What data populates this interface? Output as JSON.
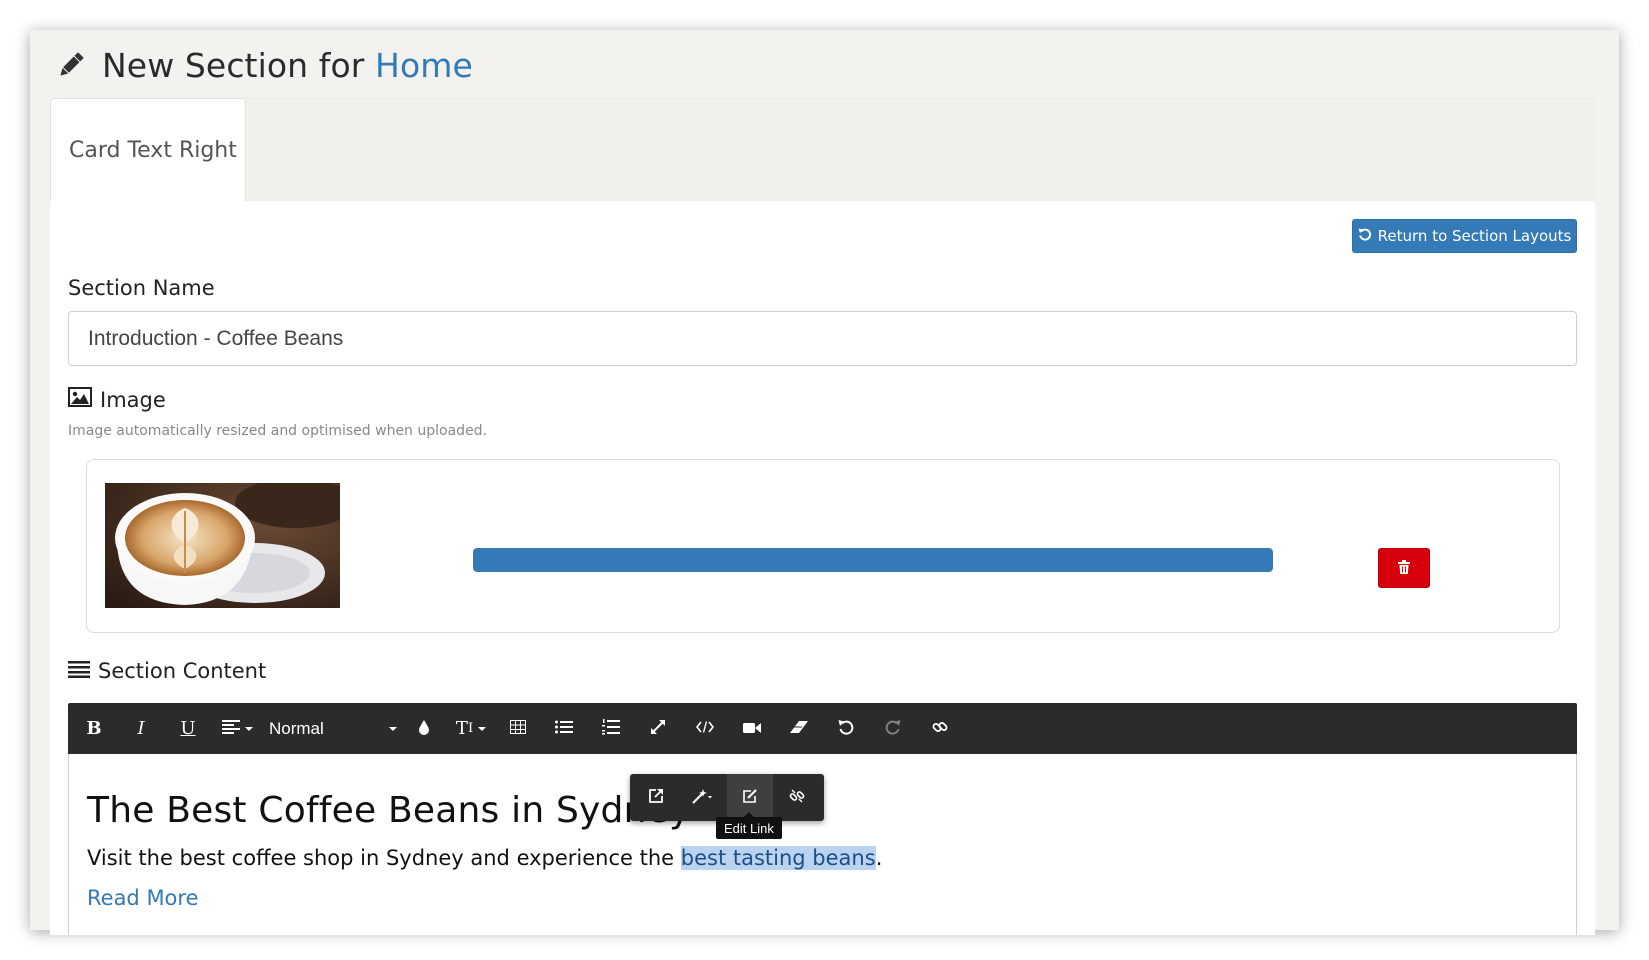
{
  "header": {
    "title_prefix": "New Section for",
    "title_accent": "Home",
    "icon": "pencil-icon"
  },
  "tabs": [
    {
      "label": "Card Text Right",
      "active": true
    }
  ],
  "actions": {
    "return_label": "Return to Section Layouts"
  },
  "form": {
    "section_name_label": "Section Name",
    "section_name_value": "Introduction - Coffee Beans",
    "image_label": "Image",
    "image_help": "Image automatically resized and optimised when uploaded.",
    "image_alt": "Latte art coffee cup",
    "upload_progress": 1.0,
    "content_label": "Section Content"
  },
  "toolbar": {
    "bold": "B",
    "italic": "I",
    "underline": "U",
    "style_select": "Normal",
    "font_size": "T",
    "icons": [
      "bold-icon",
      "italic-icon",
      "underline-icon",
      "align-icon",
      "style-select",
      "color-icon",
      "font-size-icon",
      "table-icon",
      "bullet-list-icon",
      "numbered-list-icon",
      "fullscreen-icon",
      "code-view-icon",
      "video-icon",
      "eraser-icon",
      "undo-icon",
      "redo-icon",
      "link-icon"
    ]
  },
  "editor": {
    "heading": "The Best Coffee Beans in Sydney",
    "paragraph_before": "Visit the best coffee shop in Sydney and experience the ",
    "paragraph_link": "best tasting beans",
    "paragraph_after": ".",
    "read_more": "Read More"
  },
  "link_popover": {
    "icons": [
      "open-link-icon",
      "link-style-icon",
      "edit-link-icon",
      "unlink-icon"
    ],
    "tooltip": "Edit Link"
  },
  "colors": {
    "accent": "#337ab7",
    "danger": "#d9000d",
    "toolbar": "#2b2b2b",
    "selection": "#b9d3f0"
  }
}
